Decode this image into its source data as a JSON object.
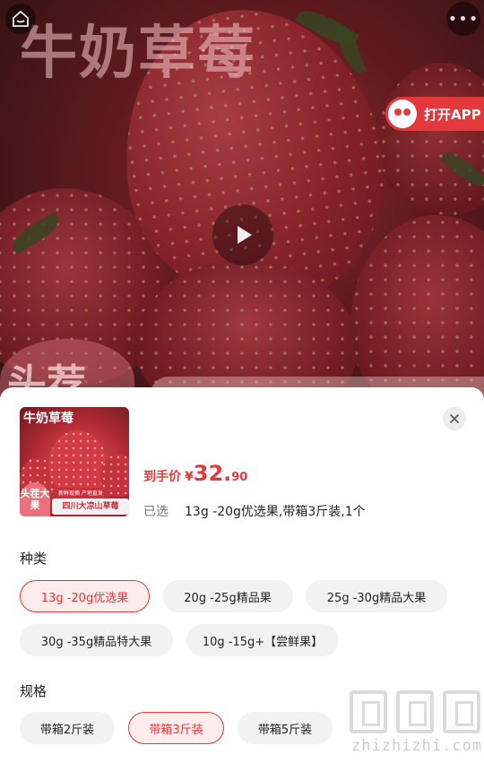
{
  "hero": {
    "title": "牛奶草莓",
    "sticker": "头荐",
    "open_app_label": "打开APP"
  },
  "product": {
    "thumb_title": "牛奶草莓",
    "thumb_badge": "头茬大果",
    "thumb_strip": "四川大凉山草莓",
    "thumb_note": "新鲜现摘 产地直发",
    "price_label": "到手价",
    "price_currency": "¥",
    "price_integer": "32.",
    "price_decimal": "90",
    "selected_label": "已选",
    "selected_value": "13g -20g优选果,带箱3斤装,1个"
  },
  "variety": {
    "title": "种类",
    "options": [
      {
        "label": "13g -20g优选果",
        "active": true
      },
      {
        "label": "20g -25g精品果",
        "active": false
      },
      {
        "label": "25g -30g精品大果",
        "active": false
      },
      {
        "label": "30g -35g精品特大果",
        "active": false
      },
      {
        "label": "10g -15g+【尝鲜果】",
        "active": false
      }
    ]
  },
  "spec": {
    "title": "规格",
    "options": [
      {
        "label": "带箱2斤装",
        "active": false
      },
      {
        "label": "带箱3斤装",
        "active": true
      },
      {
        "label": "带箱5斤装",
        "active": false
      }
    ]
  },
  "watermark": {
    "text": "zhizhizhi.com"
  },
  "colors": {
    "accent": "#e4393c",
    "chip_bg": "#f2f2f2",
    "chip_active_bg": "#fdecec"
  }
}
